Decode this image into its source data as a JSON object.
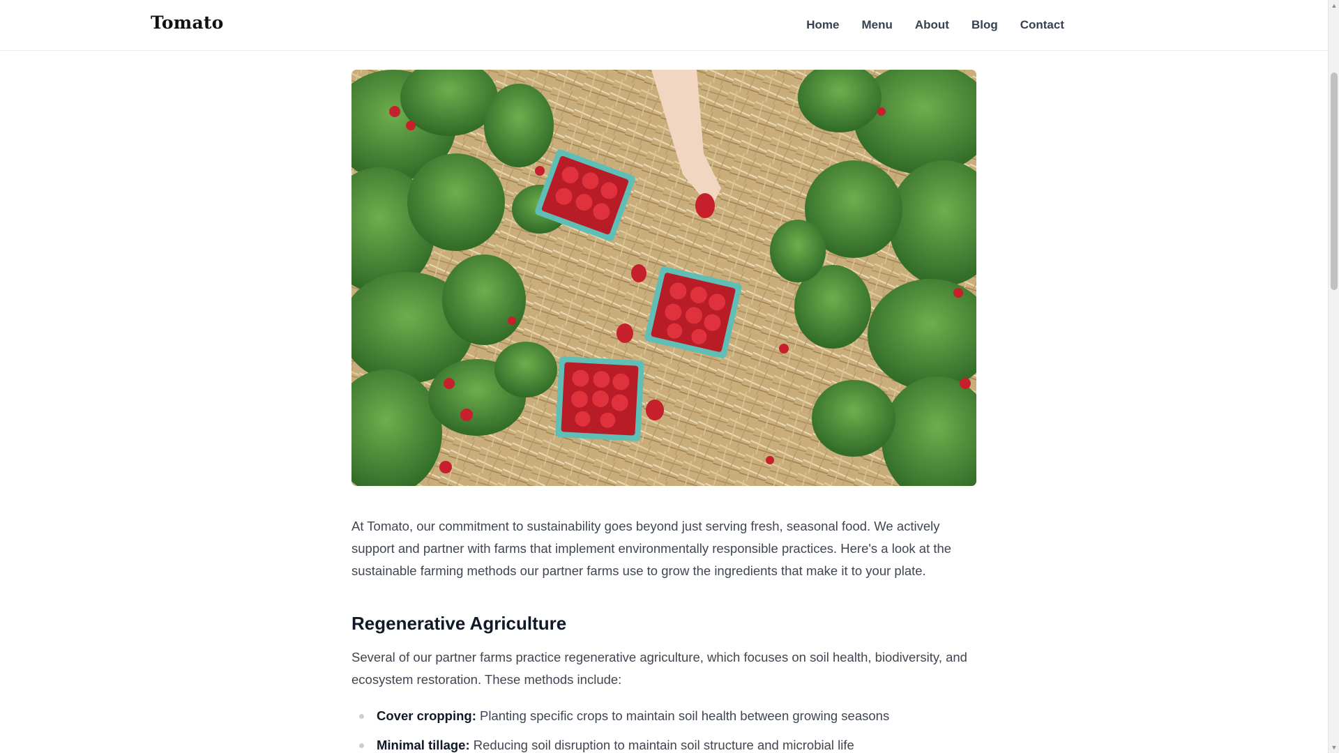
{
  "header": {
    "logo": "Tomato",
    "nav": [
      "Home",
      "Menu",
      "About",
      "Blog",
      "Contact"
    ]
  },
  "hero": {
    "description": "Strawberries in teal baskets on straw between strawberry plants"
  },
  "article": {
    "intro": "At Tomato, our commitment to sustainability goes beyond just serving fresh, seasonal food. We actively support and partner with farms that implement environmentally responsible practices. Here's a look at the sustainable farming methods our partner farms use to grow the ingredients that make it to your plate.",
    "section_heading": "Regenerative Agriculture",
    "section_text": "Several of our partner farms practice regenerative agriculture, which focuses on soil health, biodiversity, and ecosystem restoration. These methods include:",
    "methods": [
      {
        "term": "Cover cropping:",
        "text": " Planting specific crops to maintain soil health between growing seasons"
      },
      {
        "term": "Minimal tillage:",
        "text": " Reducing soil disruption to maintain soil structure and microbial life"
      }
    ]
  },
  "colors": {
    "straw": "#c9ae7c",
    "leaf": "#3f7f32",
    "berry": "#c5202b",
    "basket": "#5fbfb6"
  }
}
